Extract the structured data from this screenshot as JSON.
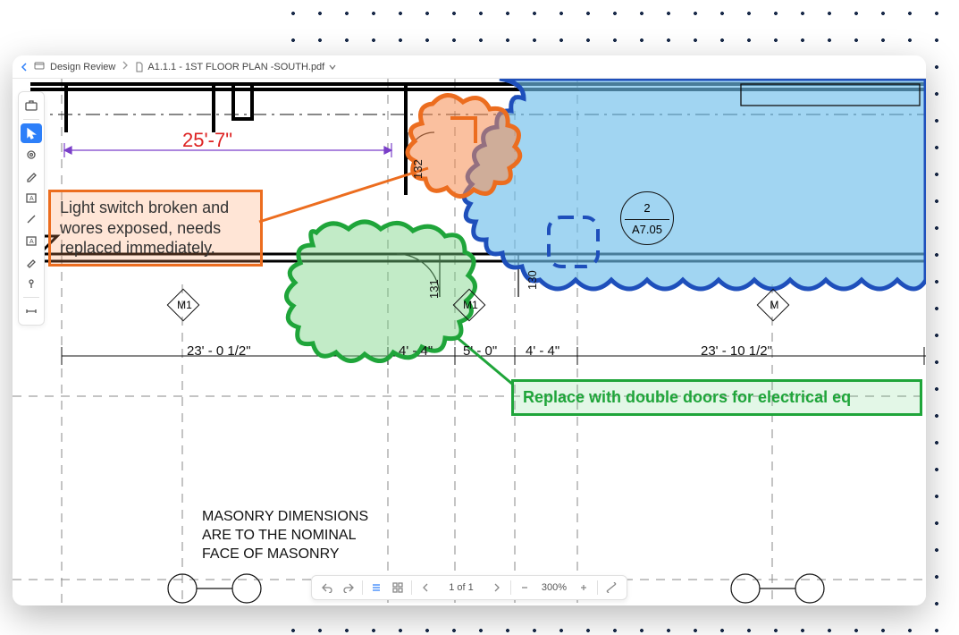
{
  "breadcrumb": {
    "section": "Design Review",
    "filename": "A1.1.1 - 1ST FLOOR PLAN -SOUTH.pdf"
  },
  "tools": [
    {
      "name": "toolbox-icon",
      "label": "Toolbox"
    },
    {
      "name": "select-icon",
      "label": "Select",
      "active": true
    },
    {
      "name": "gear-icon",
      "label": "Settings"
    },
    {
      "name": "pen-icon",
      "label": "Pen"
    },
    {
      "name": "text-box-icon",
      "label": "Text Box A"
    },
    {
      "name": "line-icon",
      "label": "Line"
    },
    {
      "name": "text-annotation-icon",
      "label": "Text Annotation A"
    },
    {
      "name": "pencil-icon",
      "label": "Pencil"
    },
    {
      "name": "pin-icon",
      "label": "Pin"
    },
    {
      "name": "dimension-icon",
      "label": "Dimension"
    }
  ],
  "annotations": {
    "orange_callout": "Light switch broken and wores exposed, needs replaced immediately.",
    "green_callout": "Replace with double doors for electrical eq"
  },
  "plan": {
    "red_dimension": "25'-7\"",
    "dimensions": {
      "d1": "23' - 0 1/2\"",
      "d2": "4' - 4\"",
      "d3": "5' - 0\"",
      "d4": "4' - 4\"",
      "d5": "23' - 10 1/2\""
    },
    "doors": {
      "a": "132",
      "b": "131",
      "c": "130"
    },
    "grid_markers": {
      "m1": "M1",
      "m1_2": "M1",
      "m_far": "M"
    },
    "reference": {
      "num": "2",
      "sheet": "A7.05"
    },
    "note_line1": "MASONRY DIMENSIONS",
    "note_line2": "ARE TO THE NOMINAL",
    "note_line3": "FACE OF MASONRY"
  },
  "bottombar": {
    "page": "1 of 1",
    "zoom": "300%"
  }
}
